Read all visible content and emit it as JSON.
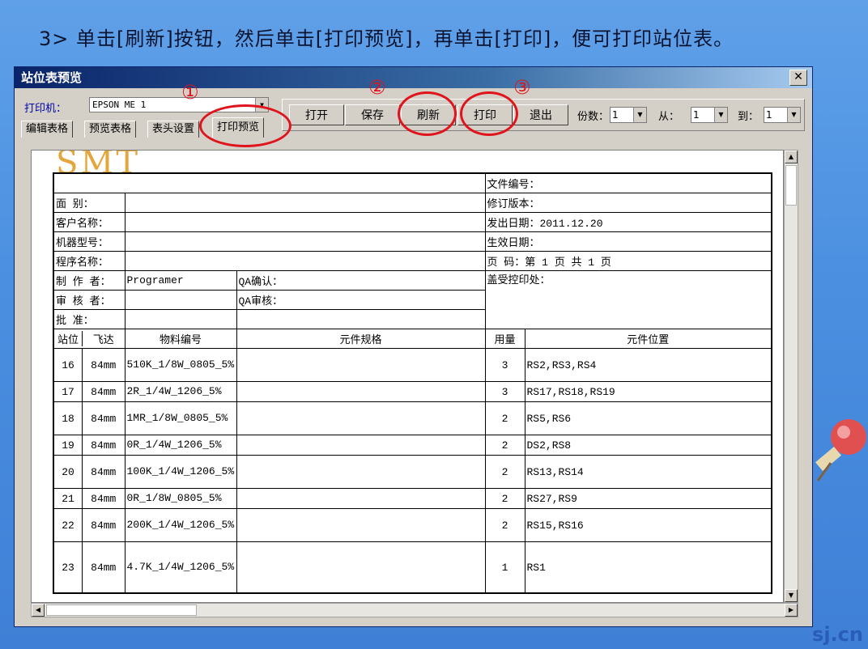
{
  "instruction": "3> 单击[刷新]按钮，然后单击[打印预览]，再单击[打印]，便可打印站位表。",
  "window": {
    "title": "站位表预览",
    "close_label": "✕"
  },
  "printer": {
    "label": "打印机：",
    "value": "EPSON ME 1"
  },
  "tabs": [
    "编辑表格",
    "预览表格",
    "表头设置",
    "打印预览"
  ],
  "toolbar": {
    "open": "打开",
    "save": "保存",
    "refresh": "刷新",
    "print": "打印",
    "exit": "退出",
    "copies_label": "份数：",
    "copies_value": "1",
    "from_label": "从：",
    "from_value": "1",
    "to_label": "到：",
    "to_value": "1"
  },
  "annotations": {
    "n1": "①",
    "n2": "②",
    "n3": "③"
  },
  "colors": {
    "annotation": "#e0141c",
    "logo": "#e4a63a"
  },
  "logo_text": "SMT",
  "form": {
    "doc_no": "文件编号：",
    "rev": "修订版本：",
    "face": "面    别：",
    "customer": "客户名称：",
    "issue_date": "发出日期：2011.12.20",
    "model": "机器型号：",
    "effective_date": "生效日期：",
    "program": "程序名称：",
    "page": "页    码：第 1 页    共 1 页",
    "maker_label": "制 作 者：",
    "maker_value": "Programer",
    "qa_confirm": "QA确认：",
    "stamp": "盖受控印处：",
    "reviewer_label": "审 核 者：",
    "qa_review": "QA审核：",
    "approver_label": "批    准："
  },
  "table_headers": [
    "站位",
    "飞达",
    "物料编号",
    "元件规格",
    "用量",
    "元件位置"
  ],
  "rows": [
    {
      "station": "16",
      "feeder": "84mm",
      "part": "510K_1/8W_0805_5%",
      "qty": "3",
      "pos": "RS2,RS3,RS4"
    },
    {
      "station": "17",
      "feeder": "84mm",
      "part": "2R_1/4W_1206_5%",
      "qty": "3",
      "pos": "RS17,RS18,RS19"
    },
    {
      "station": "18",
      "feeder": "84mm",
      "part": "1MR_1/8W_0805_5%",
      "qty": "2",
      "pos": "RS5,RS6"
    },
    {
      "station": "19",
      "feeder": "84mm",
      "part": "0R_1/4W_1206_5%",
      "qty": "2",
      "pos": "DS2,RS8"
    },
    {
      "station": "20",
      "feeder": "84mm",
      "part": "100K_1/4W_1206_5%",
      "qty": "2",
      "pos": "RS13,RS14"
    },
    {
      "station": "21",
      "feeder": "84mm",
      "part": "0R_1/8W_0805_5%",
      "qty": "2",
      "pos": "RS27,RS9"
    },
    {
      "station": "22",
      "feeder": "84mm",
      "part": "200K_1/4W_1206_5%",
      "qty": "2",
      "pos": "RS15,RS16"
    },
    {
      "station": "23",
      "feeder": "84mm",
      "part": "4.7K_1/4W_1206_5%",
      "qty": "1",
      "pos": "RS1"
    }
  ],
  "watermark": "sj.cn"
}
